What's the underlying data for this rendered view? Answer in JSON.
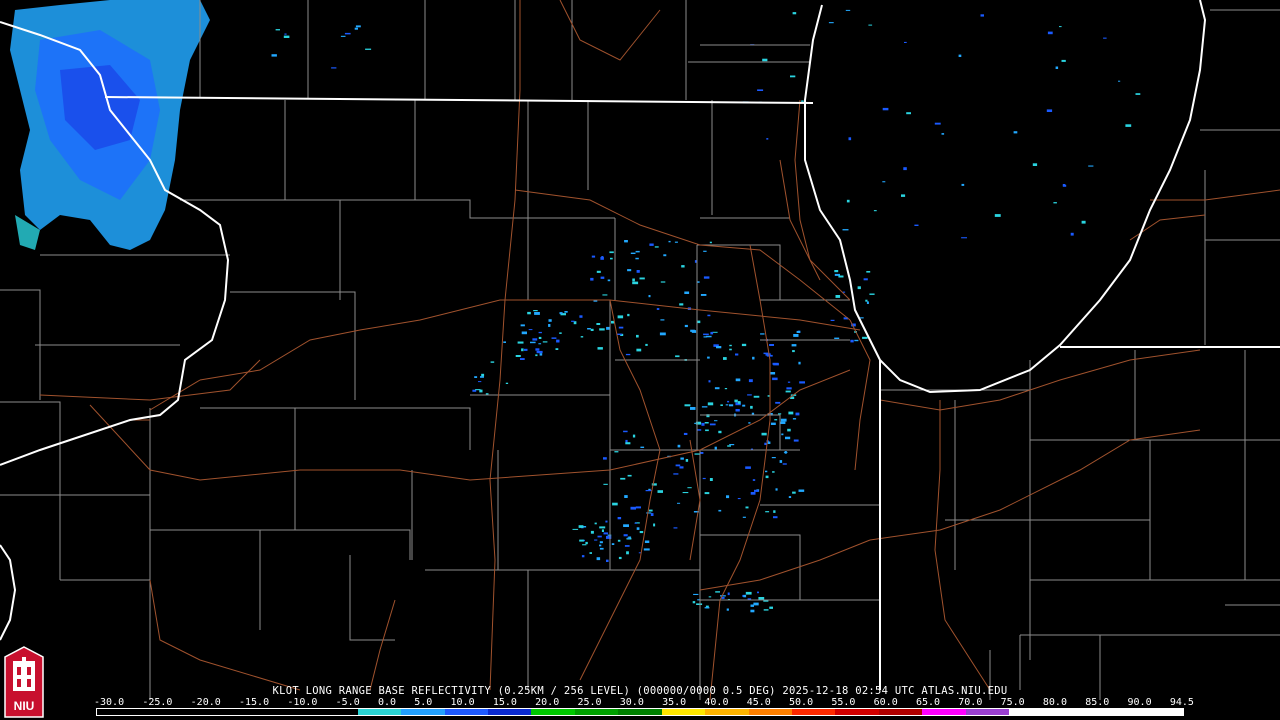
{
  "product_title": "KLOT LONG RANGE BASE REFLECTIVITY (0.25KM / 256 LEVEL) (000000/0000 0.5 DEG) 2025-12-18 02:54 UTC  ATLAS.NIU.EDU",
  "scale": {
    "labels": [
      "-30.0",
      "-25.0",
      "-20.0",
      "-15.0",
      "-10.0",
      "-5.0",
      "0.0",
      "5.0",
      "10.0",
      "15.0",
      "20.0",
      "25.0",
      "30.0",
      "35.0",
      "40.0",
      "45.0",
      "50.0",
      "55.0",
      "60.0",
      "65.0",
      "70.0",
      "75.0",
      "80.0",
      "85.0",
      "90.0",
      "94.5"
    ],
    "colors": [
      "#000000",
      "#000000",
      "#000000",
      "#000000",
      "#000000",
      "#000000",
      "#2ad4d4",
      "#22a0ff",
      "#1e5aff",
      "#0a2ad0",
      "#00c800",
      "#00a000",
      "#008000",
      "#ffe600",
      "#ffb400",
      "#ff8000",
      "#ff2a00",
      "#d20000",
      "#b00000",
      "#ff00ff",
      "#9a40d0",
      "#ffffff",
      "#ffffff",
      "#ffffff",
      "#ffffff"
    ]
  },
  "logo": {
    "text": "NIU",
    "color": "#c8102e"
  },
  "map_colors": {
    "state": "#ffffff",
    "county": "#8c8c8c",
    "road": "#a0522d",
    "echo_light": "#22a8ff",
    "echo_cyan": "#2ad4e0",
    "echo_dark": "#1a5aff"
  }
}
